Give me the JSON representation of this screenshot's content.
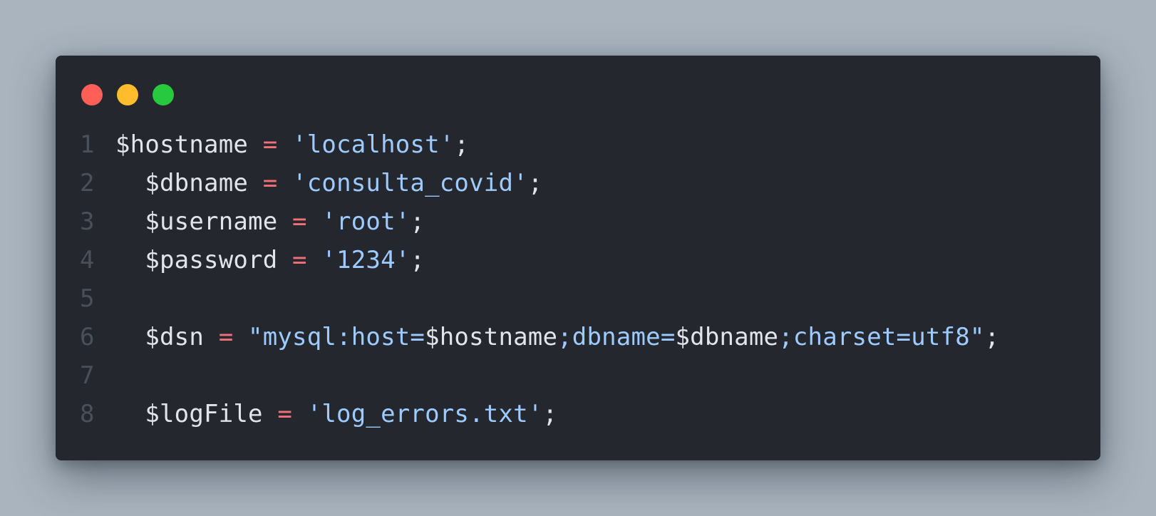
{
  "window": {
    "traffic_lights": [
      {
        "name": "close",
        "color": "#ff5f56"
      },
      {
        "name": "minimize",
        "color": "#ffbd2e"
      },
      {
        "name": "maximize",
        "color": "#27c93f"
      }
    ]
  },
  "code": {
    "lines": [
      {
        "number": "1",
        "indent": "",
        "var": "$hostname",
        "op": "=",
        "value": "'localhost'",
        "end": ";"
      },
      {
        "number": "2",
        "indent": "  ",
        "var": "$dbname",
        "op": "=",
        "value": "'consulta_covid'",
        "end": ";"
      },
      {
        "number": "3",
        "indent": "  ",
        "var": "$username",
        "op": "=",
        "value": "'root'",
        "end": ";"
      },
      {
        "number": "4",
        "indent": "  ",
        "var": "$password",
        "op": "=",
        "value": "'1234'",
        "end": ";"
      },
      {
        "number": "5"
      },
      {
        "number": "6",
        "indent": "  ",
        "var": "$dsn",
        "op": "=",
        "parts": [
          "\"mysql:host=",
          "$hostname",
          ";dbname=",
          "$dbname",
          ";charset=utf8\""
        ],
        "end": ";"
      },
      {
        "number": "7"
      },
      {
        "number": "8",
        "indent": "  ",
        "var": "$logFile",
        "op": "=",
        "value": "'log_errors.txt'",
        "end": ";"
      }
    ]
  },
  "colors": {
    "background": "#a9b4bf",
    "editor": "#24282e",
    "operator": "#f07178",
    "string": "#9ecbff",
    "text": "#e1e4e8",
    "line_number": "#4a5059"
  }
}
